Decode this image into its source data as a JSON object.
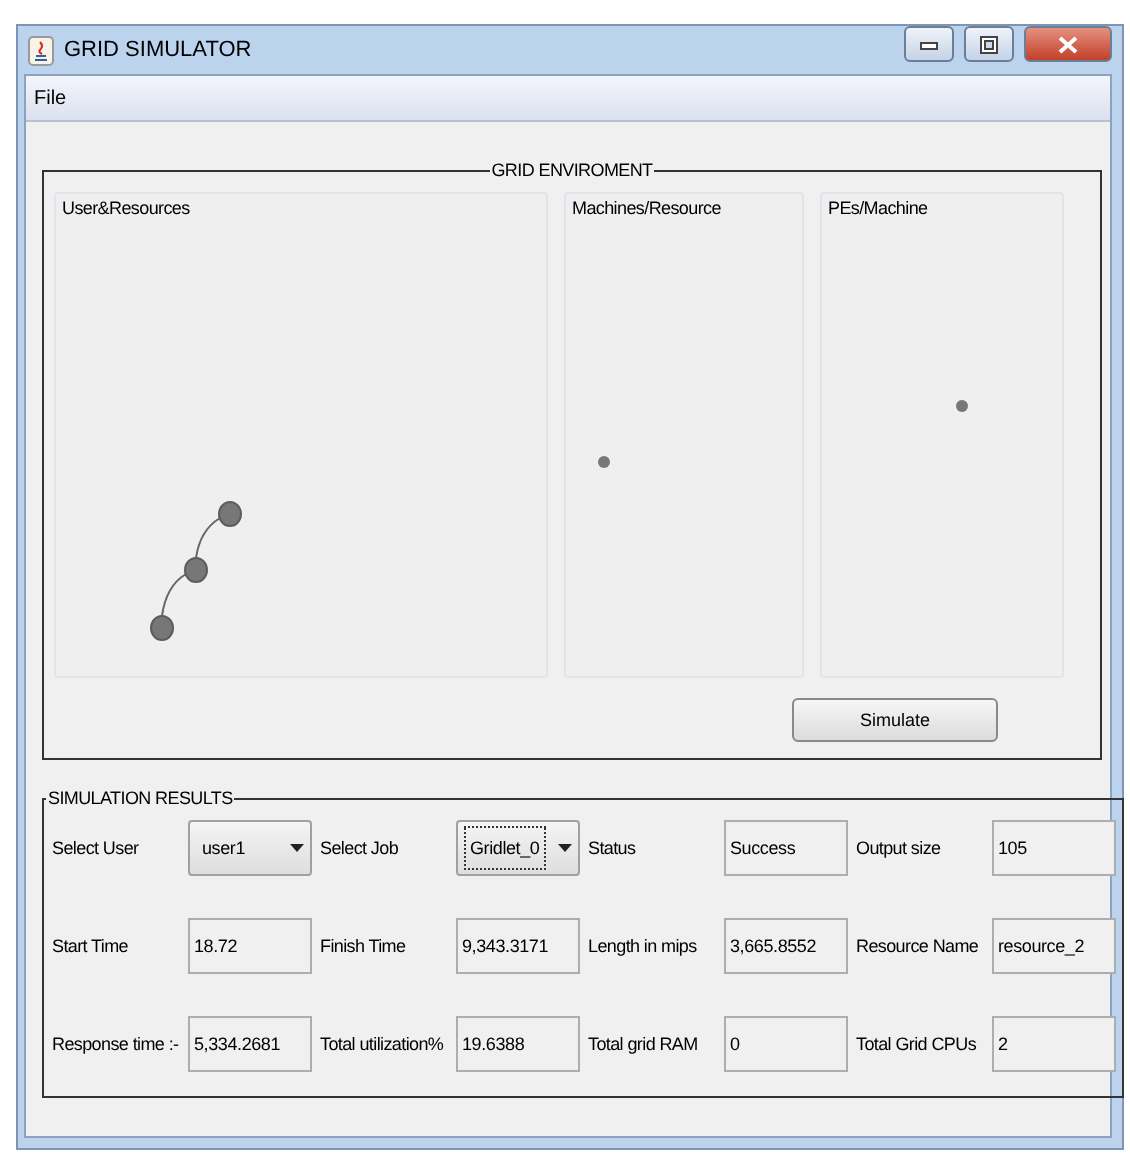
{
  "window": {
    "title": "GRID SIMULATOR"
  },
  "menu": [
    "File"
  ],
  "environment": {
    "title": "GRID ENVIROMENT",
    "panels": [
      {
        "title": "User&Resources",
        "kind": "chain"
      },
      {
        "title": "Machines/Resource",
        "kind": "dot"
      },
      {
        "title": "PEs/Machine",
        "kind": "dot"
      }
    ],
    "button": "Simulate"
  },
  "results": {
    "title": "SIMULATION RESULTS",
    "rows": [
      [
        {
          "label": "Select User",
          "value": "user1",
          "kind": "combo",
          "focused": false
        },
        {
          "label": "Select Job",
          "value": "Gridlet_0",
          "kind": "combo",
          "focused": true
        },
        {
          "label": "Status",
          "value": "Success",
          "kind": "text"
        },
        {
          "label": "Output size",
          "value": "105",
          "kind": "text"
        }
      ],
      [
        {
          "label": "Start Time",
          "value": "18.72",
          "kind": "text"
        },
        {
          "label": "Finish Time",
          "value": "9,343.3171",
          "kind": "text"
        },
        {
          "label": "Length in mips",
          "value": "3,665.8552",
          "kind": "text"
        },
        {
          "label": "Resource Name",
          "value": "resource_2",
          "kind": "text"
        }
      ],
      [
        {
          "label": "Response time :-",
          "value": "5,334.2681",
          "kind": "text"
        },
        {
          "label": "Total utilization%",
          "value": "19.6388",
          "kind": "text"
        },
        {
          "label": "Total grid RAM",
          "value": "0",
          "kind": "text"
        },
        {
          "label": "Total Grid CPUs",
          "value": "2",
          "kind": "text"
        }
      ]
    ]
  }
}
